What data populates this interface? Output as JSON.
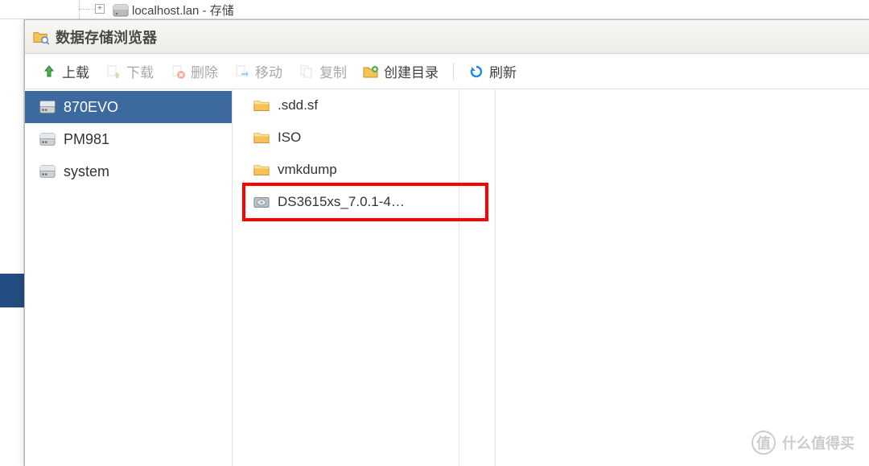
{
  "background": {
    "tree_node_label": "localhost.lan - 存储"
  },
  "window": {
    "title": "数据存储浏览器"
  },
  "toolbar": {
    "upload_label": "上载",
    "download_label": "下载",
    "delete_label": "删除",
    "move_label": "移动",
    "copy_label": "复制",
    "new_folder_label": "创建目录",
    "refresh_label": "刷新"
  },
  "datastores": [
    {
      "name": "870EVO",
      "selected": true
    },
    {
      "name": "PM981",
      "selected": false
    },
    {
      "name": "system",
      "selected": false
    }
  ],
  "files": [
    {
      "name": ".sdd.sf",
      "type": "folder",
      "highlighted": false
    },
    {
      "name": "ISO",
      "type": "folder",
      "highlighted": false
    },
    {
      "name": "vmkdump",
      "type": "folder",
      "highlighted": false
    },
    {
      "name": "DS3615xs_7.0.1-4…",
      "type": "disk",
      "highlighted": true
    }
  ],
  "colors": {
    "selection": "#3c6a9e",
    "highlight_box": "#ff0000",
    "folder_fill": "#f6c35a",
    "folder_dark": "#d79a2b"
  },
  "watermark": {
    "char": "值",
    "text": "什么值得买"
  }
}
